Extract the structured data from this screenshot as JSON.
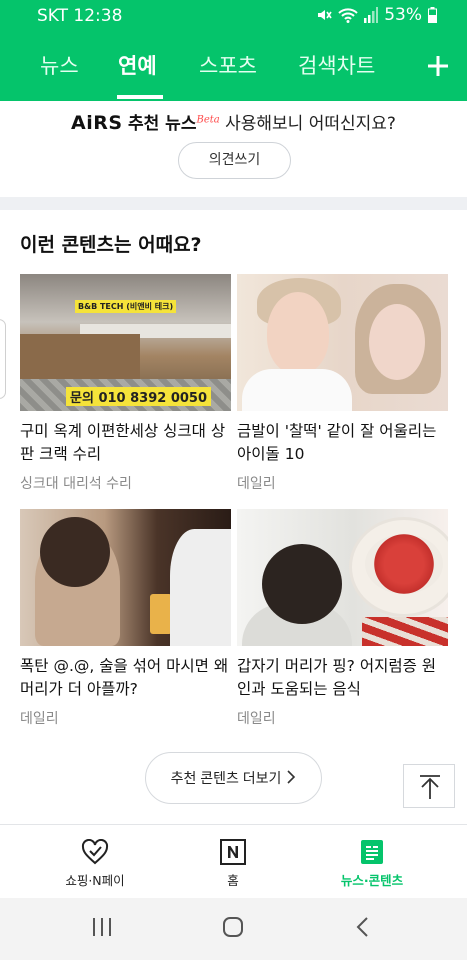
{
  "status_bar": {
    "carrier_time": "SKT 12:38",
    "battery": "53%"
  },
  "top_nav": {
    "tabs": [
      {
        "label": "뉴스"
      },
      {
        "label": "연예"
      },
      {
        "label": "스포츠"
      },
      {
        "label": "검색차트"
      }
    ],
    "active_tab": "연예",
    "add_icon": "plus-icon"
  },
  "airs": {
    "logo": "AiRS",
    "recommend": "추천 뉴스",
    "beta": "Beta",
    "question": "사용해보니 어떠신지요?",
    "opinion_button": "의견쓰기"
  },
  "recommend_section": {
    "title": "이런 콘텐츠는 어때요?",
    "cards": [
      {
        "title": "구미 옥계 이편한세상 싱크대 상판 크랙 수리",
        "source": "싱크대 대리석 수리",
        "thumb_label": "B&B TECH (비앤비 테크)",
        "thumb_phone": "문의 010 8392 0050"
      },
      {
        "title": "금발이 '찰떡' 같이 잘 어울리는 아이돌 10",
        "source": "데일리"
      },
      {
        "title": "폭탄 @.@, 술을 섞어 마시면 왜 머리가 더 아플까?",
        "source": "데일리"
      },
      {
        "title": "갑자기 머리가 핑? 어지럼증 원인과 도움되는 음식",
        "source": "데일리"
      }
    ],
    "more_button": "추천 콘텐츠 더보기"
  },
  "bottom_bar": {
    "items": [
      {
        "label": "쇼핑·N페이",
        "icon": "heart-check-icon"
      },
      {
        "label": "홈",
        "icon": "naver-n-icon"
      },
      {
        "label": "뉴스·콘텐츠",
        "icon": "news-list-icon"
      }
    ],
    "active": "뉴스·콘텐츠"
  },
  "colors": {
    "brand_green": "#05c46b",
    "beta_red": "#ff4d4d"
  }
}
